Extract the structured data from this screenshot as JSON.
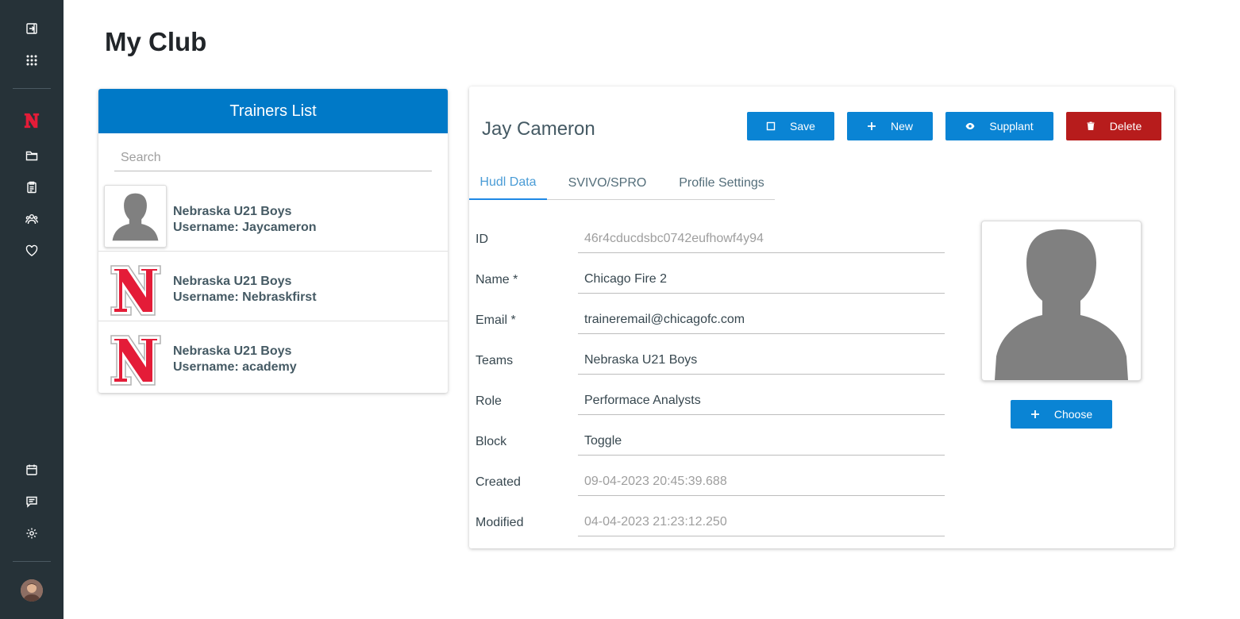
{
  "sidebar": {
    "top_icons": [
      "sign-in-icon",
      "apps-grid-icon"
    ],
    "middle_icons": [
      "nebraska-logo-icon",
      "folder-icon",
      "clipboard-icon",
      "users-icon",
      "heart-icon"
    ],
    "bottom_icons": [
      "calendar-icon",
      "chat-icon",
      "gear-icon"
    ]
  },
  "page": {
    "title": "My Club"
  },
  "trainers_list": {
    "title": "Trainers List",
    "search_placeholder": "Search",
    "items": [
      {
        "team": "Nebraska U21 Boys",
        "username": "Username: Jaycameron",
        "thumb": "silhouette"
      },
      {
        "team": "Nebraska U21 Boys",
        "username": "Username: Nebraskfirst",
        "thumb": "nebraska-logo"
      },
      {
        "team": "Nebraska U21 Boys",
        "username": "Username: academy",
        "thumb": "nebraska-logo"
      }
    ]
  },
  "detail": {
    "name": "Jay Cameron",
    "buttons": {
      "save": "Save",
      "new": "New",
      "supplant": "Supplant",
      "delete": "Delete",
      "choose": "Choose"
    },
    "tabs": [
      "Hudl Data",
      "SVIVO/SPRO",
      "Profile Settings"
    ],
    "active_tab": "Hudl Data",
    "fields": [
      {
        "label": "ID",
        "value": "46r4cducdsbc0742eufhowf4y94",
        "muted": true
      },
      {
        "label": "Name *",
        "value": "Chicago Fire 2",
        "muted": false
      },
      {
        "label": "Email *",
        "value": "traineremail@chicagofc.com",
        "muted": false
      },
      {
        "label": "Teams",
        "value": "Nebraska U21 Boys",
        "muted": false
      },
      {
        "label": "Role",
        "value": "Performace Analysts",
        "muted": false
      },
      {
        "label": "Block",
        "value": "Toggle",
        "muted": false
      },
      {
        "label": "Created",
        "value": "09-04-2023 20:45:39.688",
        "muted": true
      },
      {
        "label": "Modified",
        "value": "04-04-2023 21:23:12.250",
        "muted": true
      }
    ]
  },
  "colors": {
    "sidebar": "#263238",
    "primary": "#0a84d4",
    "header": "#0079c7",
    "danger": "#b71c1c",
    "nebraska_red": "#e41c38"
  }
}
